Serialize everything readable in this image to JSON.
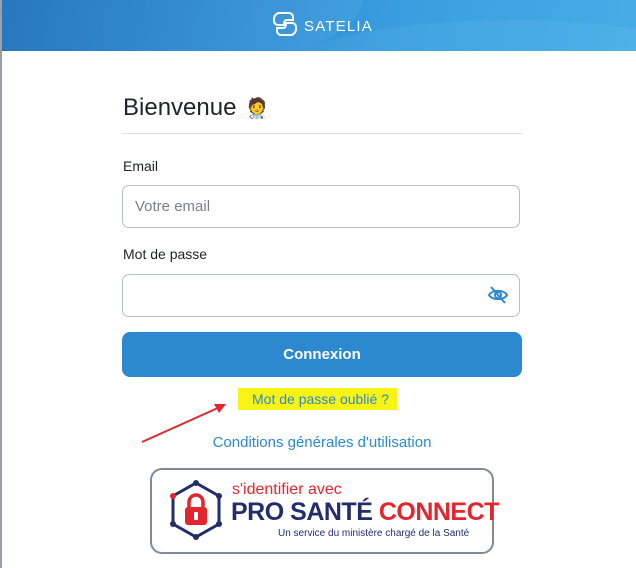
{
  "header": {
    "brand": "SATELIA"
  },
  "login": {
    "title": "Bienvenue",
    "title_emoji": "🧑‍⚕️",
    "email_label": "Email",
    "email_placeholder": "Votre email",
    "email_value": "",
    "password_label": "Mot de passe",
    "password_value": "",
    "submit_label": "Connexion",
    "forgot_link": "Mot de passe oublié ?",
    "terms_link": "Conditions générales d'utilisation"
  },
  "pro_sante_connect": {
    "tagline": "s'identifier avec",
    "word_pro": "PRO",
    "word_sante": "SANTÉ",
    "word_connect": "CONNECT",
    "subtitle": "Un service du ministère chargé de la Santé"
  },
  "colors": {
    "primary": "#2d89cf",
    "highlight": "#f7f314",
    "annotation_arrow": "#e3262e",
    "psc_navy": "#232d6b",
    "psc_red": "#e3262e"
  },
  "icons": {
    "brand_logo": "satelia-logo-icon",
    "password_toggle": "eye-slash-icon",
    "psc_logo": "padlock-icon"
  }
}
